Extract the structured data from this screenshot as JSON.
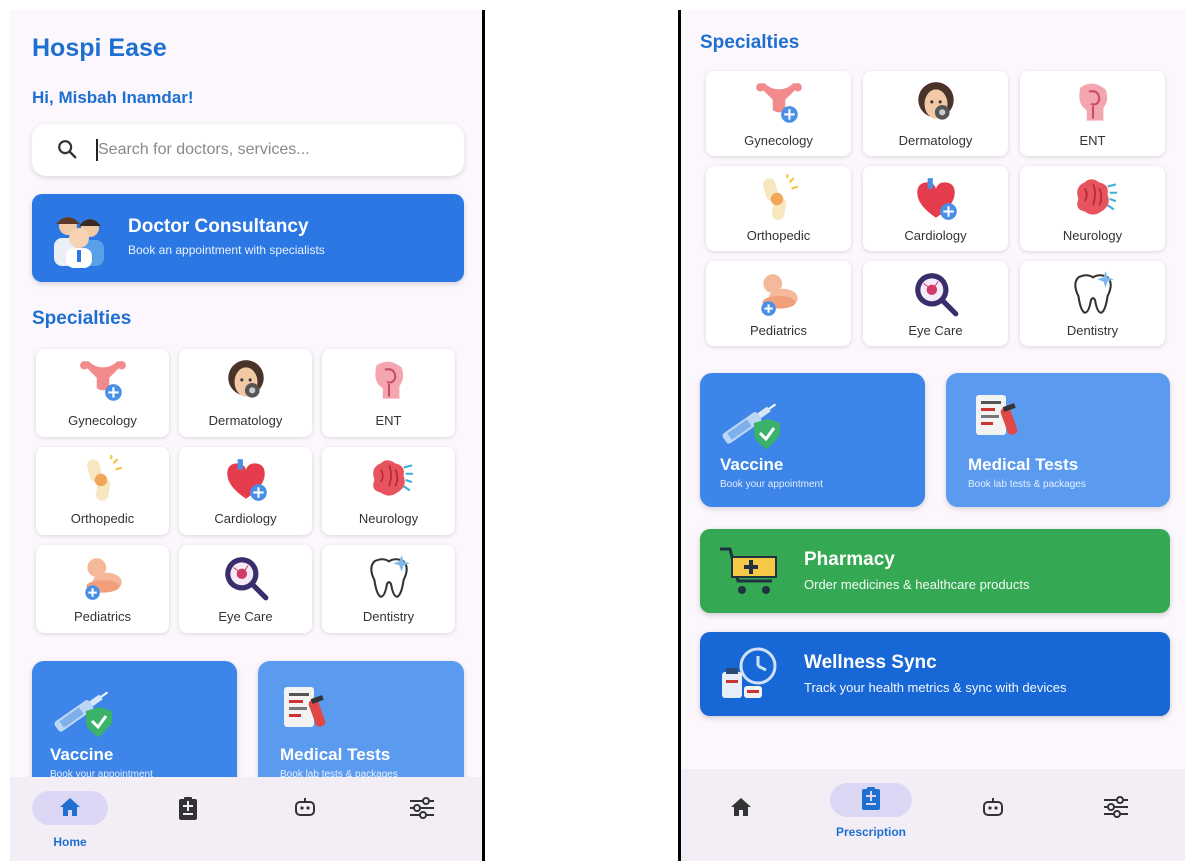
{
  "app": {
    "title": "Hospi Ease",
    "greeting": "Hi, Misbah Inamdar!"
  },
  "search": {
    "placeholder": "Search for doctors, services..."
  },
  "consultancy": {
    "title": "Doctor Consultancy",
    "subtitle": "Book an appointment with specialists"
  },
  "specialties": {
    "title": "Specialties",
    "items": [
      {
        "label": "Gynecology",
        "icon": "uterus-icon"
      },
      {
        "label": "Dermatology",
        "icon": "skin-face-icon"
      },
      {
        "label": "ENT",
        "icon": "ear-nose-throat-icon"
      },
      {
        "label": "Orthopedic",
        "icon": "knee-joint-icon"
      },
      {
        "label": "Cardiology",
        "icon": "heart-icon"
      },
      {
        "label": "Neurology",
        "icon": "brain-icon"
      },
      {
        "label": "Pediatrics",
        "icon": "baby-icon"
      },
      {
        "label": "Eye Care",
        "icon": "eye-magnifier-icon"
      },
      {
        "label": "Dentistry",
        "icon": "tooth-icon"
      }
    ]
  },
  "services": {
    "vaccine": {
      "title": "Vaccine",
      "subtitle": "Book your appointment"
    },
    "medical_tests": {
      "title": "Medical Tests",
      "subtitle": "Book lab tests & packages"
    },
    "pharmacy": {
      "title": "Pharmacy",
      "subtitle": "Order medicines & healthcare products"
    },
    "wellness": {
      "title": "Wellness Sync",
      "subtitle": "Track your health metrics & sync with devices"
    }
  },
  "nav_left": {
    "active_label": "Home"
  },
  "nav_right": {
    "active_label": "Prescription"
  },
  "colors": {
    "primary": "#1f6fd1",
    "consult_bg": "#2b78e4",
    "vaccine_bg": "#3d85e8",
    "tests_bg": "#5a9bf0",
    "pharmacy_bg": "#34a853",
    "wellness_bg": "#1867d6",
    "nav_pill": "#dcd7f4"
  }
}
